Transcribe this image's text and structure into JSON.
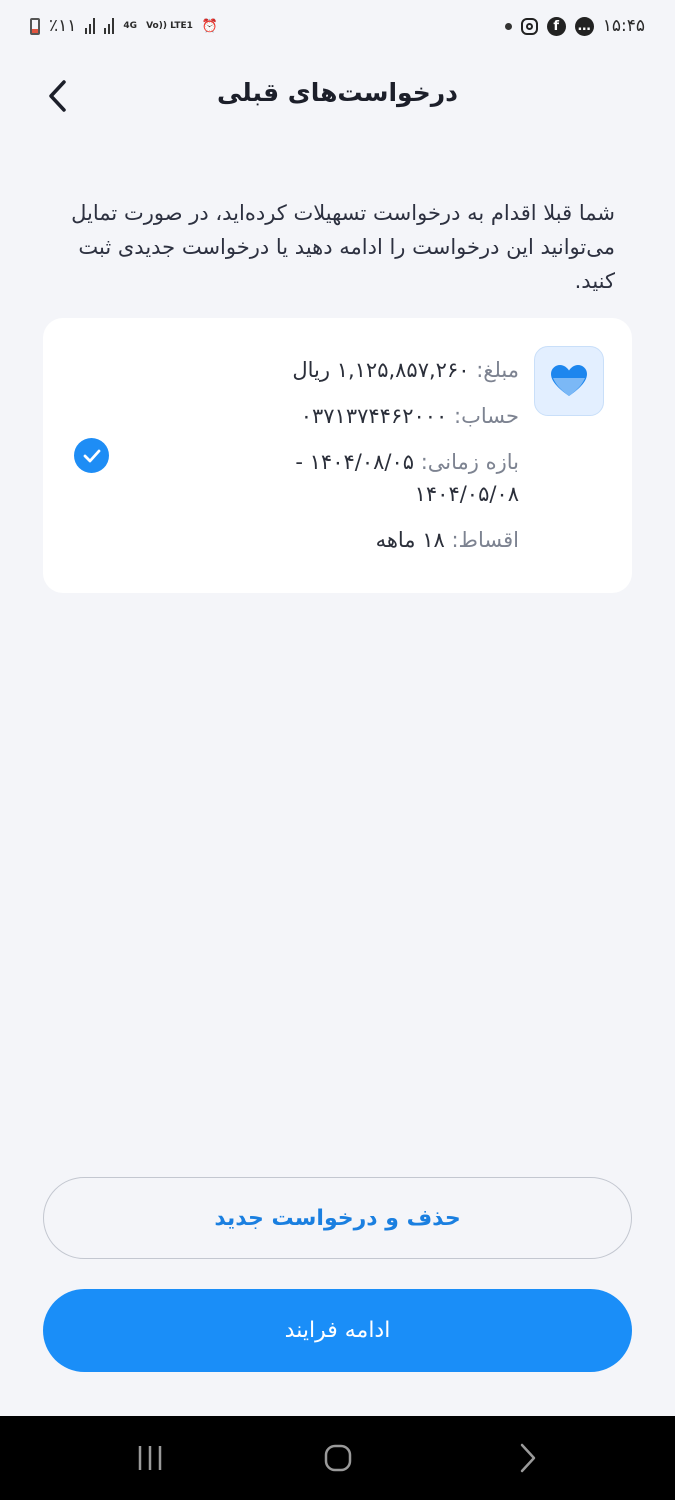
{
  "status_bar": {
    "time": "۱۵:۴۵",
    "battery_text": "٪۱۱",
    "network_4g": "4G",
    "network_volte": "Vo)) LTE1"
  },
  "header": {
    "title": "درخواست‌های قبلی",
    "back_icon": "chevron-left-icon"
  },
  "description": "شما قبلا اقدام به درخواست تسهیلات کرده‌اید، در صورت تمایل می‌توانید این درخواست را ادامه دهید یا درخواست جدیدی ثبت کنید.",
  "request_card": {
    "icon": "heart-icon",
    "amount_label": "مبلغ:",
    "amount_value": "۱,۱۲۵,۸۵۷,۲۶۰ ریال",
    "account_label": "حساب:",
    "account_value": "۰۳۷۱۳۷۴۴۶۲۰۰۰",
    "period_label": "بازه زمانی:",
    "period_value": "۱۴۰۴/۰۸/۰۵ - ۱۴۰۴/۰۵/۰۸",
    "installments_label": "اقساط:",
    "installments_value": "۱۸ ماهه",
    "selected": true
  },
  "buttons": {
    "delete_new": "حذف و درخواست جدید",
    "continue": "ادامه فرایند"
  },
  "colors": {
    "primary": "#1a8ef8",
    "background": "#f4f5f9",
    "card": "#ffffff"
  }
}
